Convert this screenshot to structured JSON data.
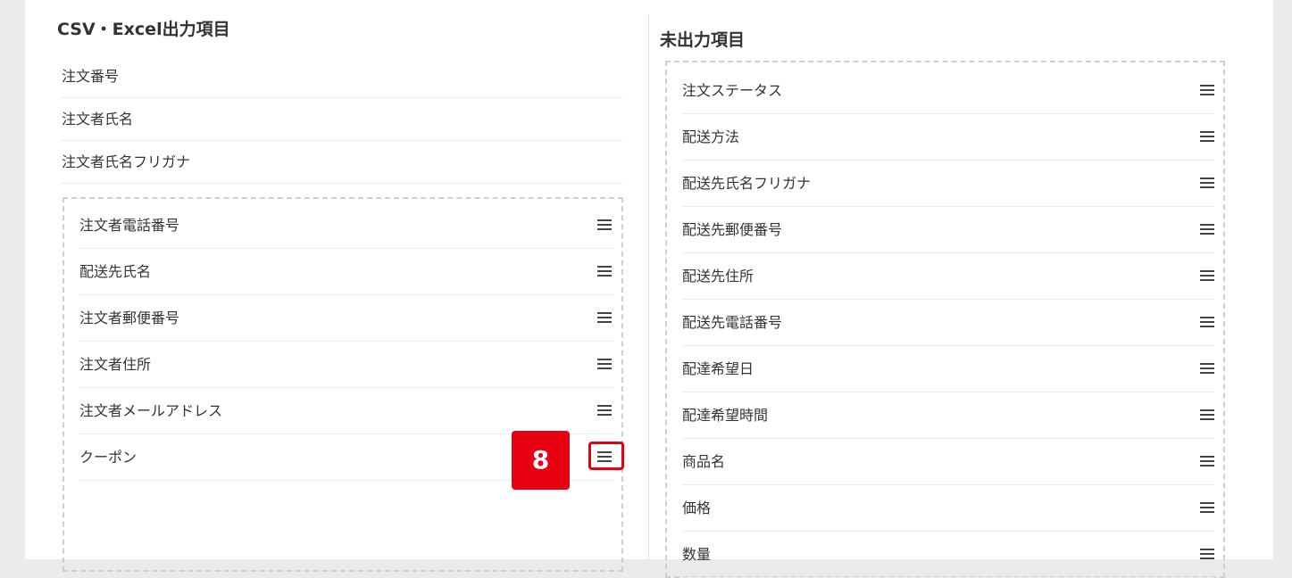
{
  "left": {
    "heading": "CSV・Excel出力項目",
    "fixed_items": [
      "注文番号",
      "注文者氏名",
      "注文者氏名フリガナ"
    ],
    "sortable_items": [
      "注文者電話番号",
      "配送先氏名",
      "注文者郵便番号",
      "注文者住所",
      "注文者メールアドレス",
      "クーポン"
    ]
  },
  "right": {
    "heading": "未出力項目",
    "items": [
      "注文ステータス",
      "配送方法",
      "配送先氏名フリガナ",
      "配送先郵便番号",
      "配送先住所",
      "配送先電話番号",
      "配達希望日",
      "配達希望時間",
      "商品名",
      "価格",
      "数量"
    ]
  },
  "callout": {
    "number": "8"
  },
  "icons": {
    "drag_handle": "hamburger-icon"
  },
  "colors": {
    "accent": "#e60012",
    "border": "#cfcfcf",
    "text": "#333333"
  }
}
